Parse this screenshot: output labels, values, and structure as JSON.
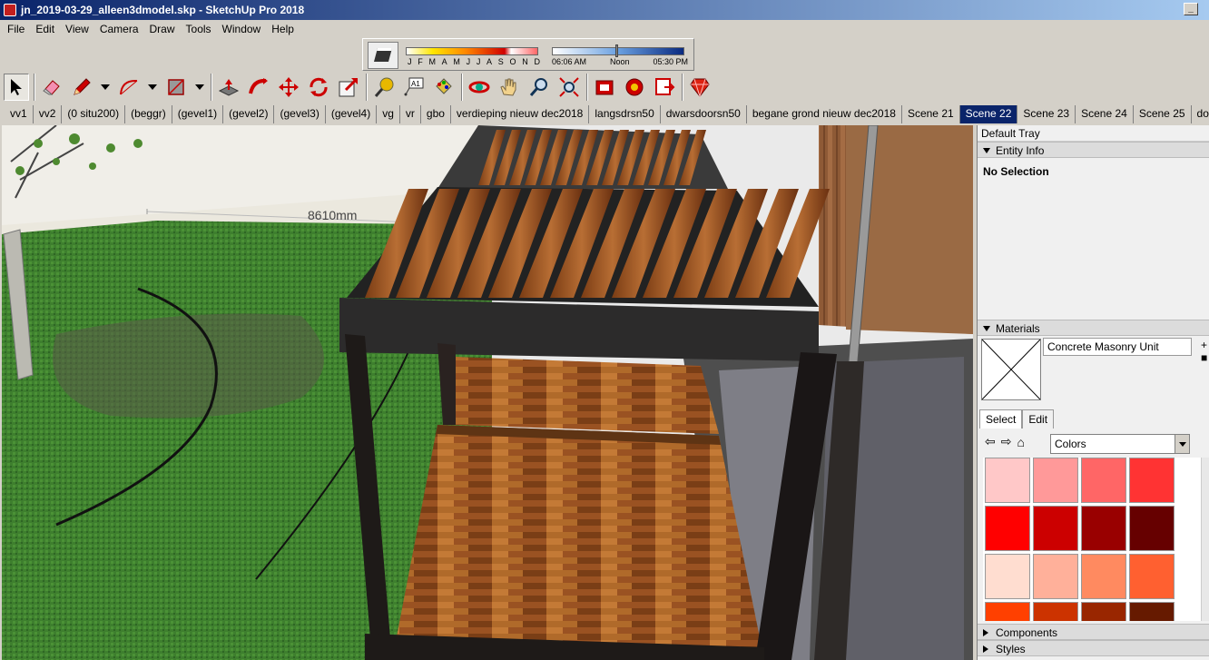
{
  "window": {
    "title": "jn_2019-03-29_alleen3dmodel.skp - SketchUp Pro 2018"
  },
  "menu": [
    "File",
    "Edit",
    "View",
    "Camera",
    "Draw",
    "Tools",
    "Window",
    "Help"
  ],
  "shadow": {
    "months": [
      "J",
      "F",
      "M",
      "A",
      "M",
      "J",
      "J",
      "A",
      "S",
      "O",
      "N",
      "D"
    ],
    "times": [
      "06:06 AM",
      "Noon",
      "05:30 PM"
    ],
    "time_position": 0.48
  },
  "toolbar": {
    "icons": [
      "select-arrow",
      "eraser",
      "pencil-line",
      "arc",
      "rectangle",
      "push-pull",
      "follow-me",
      "move",
      "rotate",
      "scale",
      "tape-measure",
      "text-label",
      "paint-bucket",
      "orbit",
      "pan-hand",
      "zoom",
      "zoom-extents",
      "warehouse",
      "extension-warehouse",
      "send-to-layout",
      "ruby-console"
    ]
  },
  "scenes": {
    "tabs": [
      "vv1",
      "vv2",
      "(0 situ200)",
      "(beggr)",
      "(gevel1)",
      "(gevel2)",
      "(gevel3)",
      "(gevel4)",
      "vg",
      "vr",
      "gbo",
      "verdieping nieuw dec2018",
      "langsdrsn50",
      "dwarsdoorsn50",
      "begane grond nieuw dec2018",
      "Scene 21",
      "Scene 22",
      "Scene 23",
      "Scene 24",
      "Scene 25",
      "doorsnede lengte"
    ],
    "active": "Scene 22"
  },
  "viewport": {
    "dimension_label": "8610mm"
  },
  "tray": {
    "title": "Default Tray",
    "entity_info": {
      "header": "Entity Info",
      "text": "No Selection"
    },
    "materials": {
      "header": "Materials",
      "material_name": "Concrete Masonry Unit",
      "tab_select": "Select",
      "tab_edit": "Edit",
      "library": "Colors",
      "swatches": [
        "#ffc8c8",
        "#ff9999",
        "#ff6666",
        "#ff3333",
        "#ff0000",
        "#cc0000",
        "#990000",
        "#660000",
        "#ffddd0",
        "#ffb09a",
        "#ff8a60",
        "#ff6030",
        "#ff4000",
        "#cc3300",
        "#992600",
        "#661a00"
      ]
    },
    "components": {
      "header": "Components"
    },
    "styles": {
      "header": "Styles"
    }
  }
}
